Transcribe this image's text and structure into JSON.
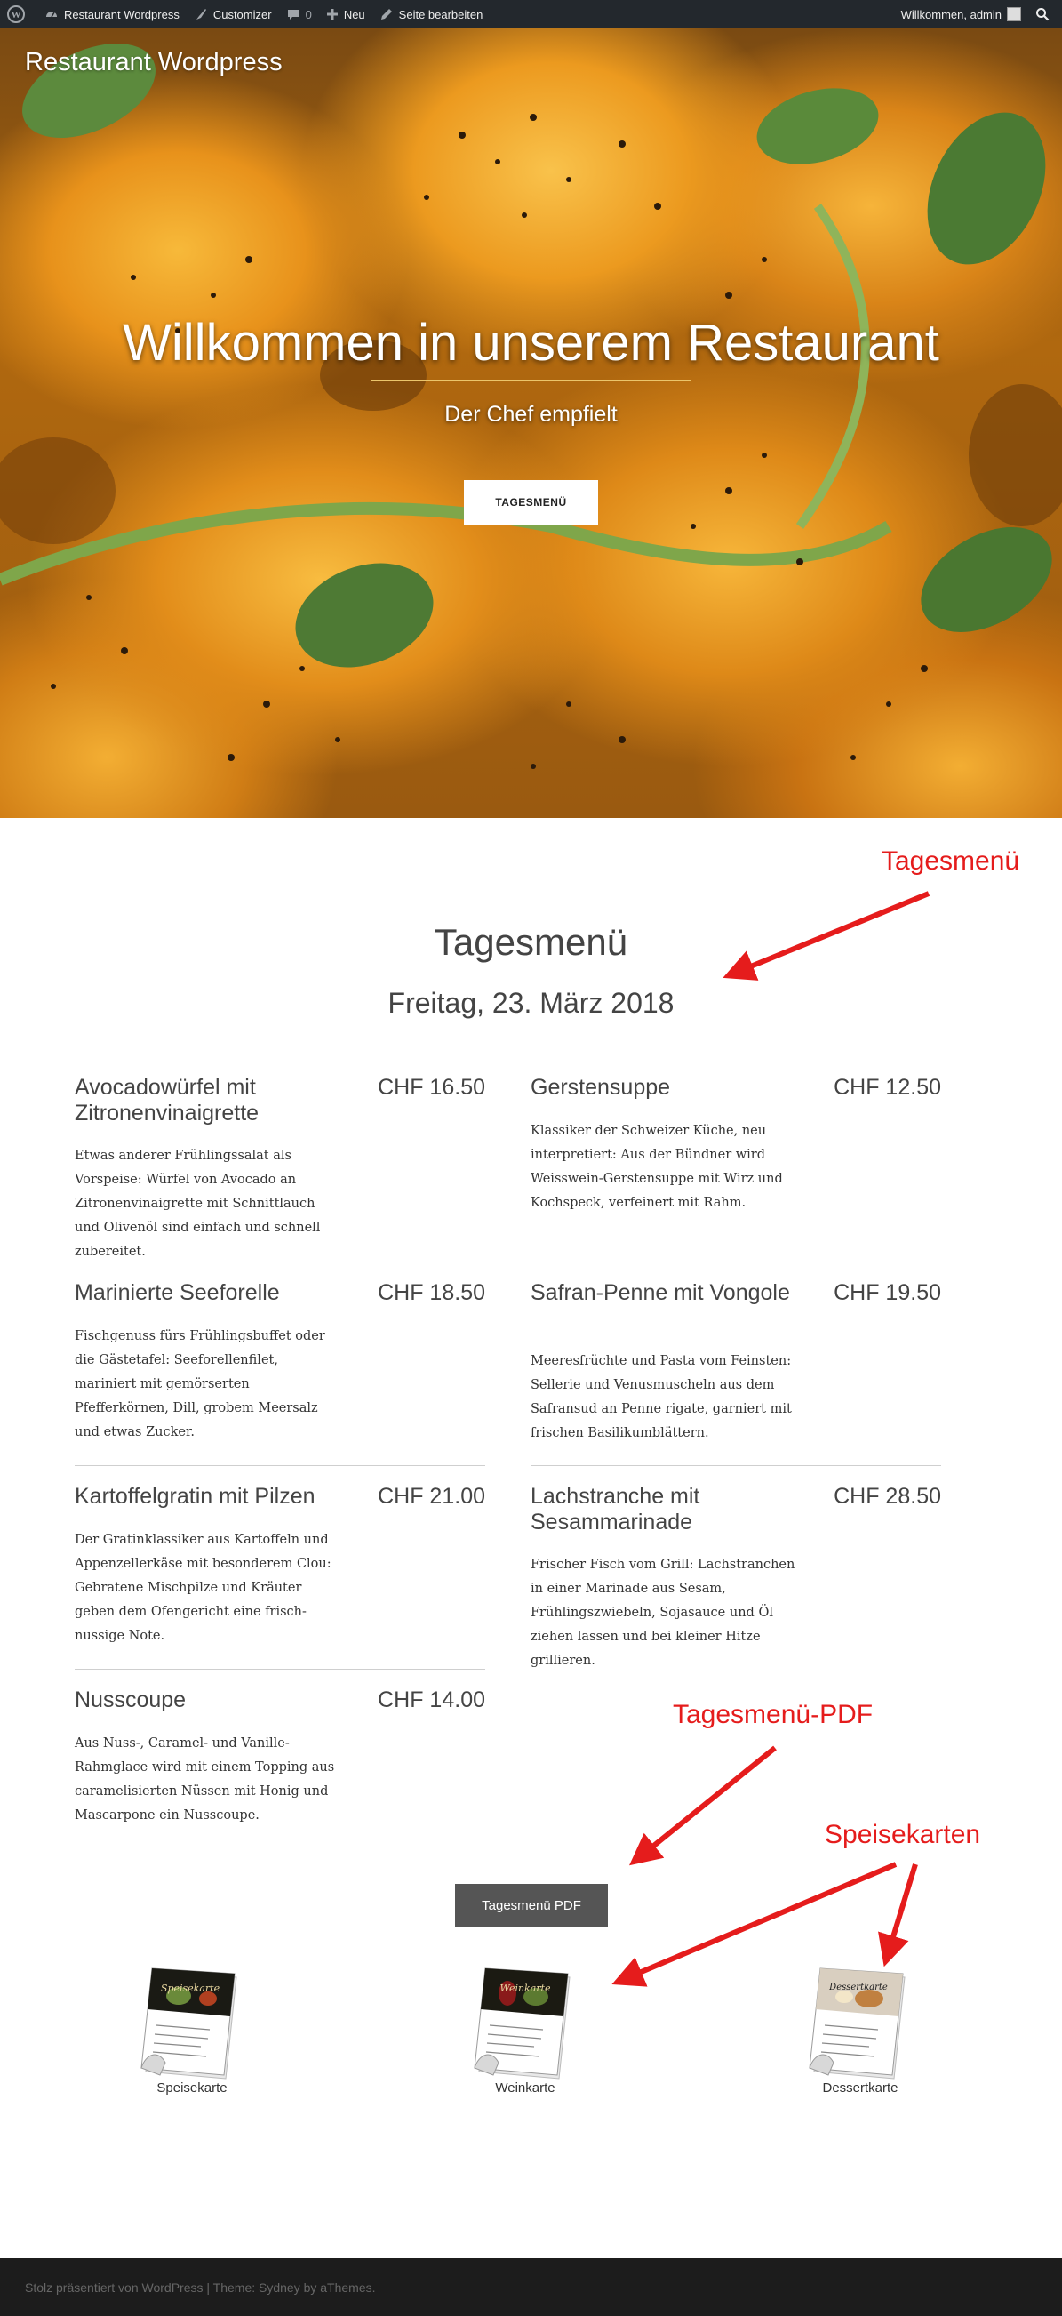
{
  "adminbar": {
    "site_name": "Restaurant Wordpress",
    "customizer": "Customizer",
    "comments_count": "0",
    "new": "Neu",
    "edit": "Seite bearbeiten",
    "greeting": "Willkommen, admin"
  },
  "hero": {
    "site_title": "Restaurant Wordpress",
    "title": "Willkommen in unserem Restaurant",
    "subtitle": "Der Chef empfielt",
    "button": "TAGESMENÜ"
  },
  "menu": {
    "title": "Tagesmenü",
    "date": "Freitag, 23. März 2018",
    "dishes": [
      {
        "name": "Avocadowürfel mit Zitronenvinaigrette",
        "price": "CHF  16.50",
        "desc": "Etwas anderer Frühlingssalat als Vorspeise: Würfel von Avocado an Zitronenvinaigrette mit Schnittlauch und Olivenöl sind einfach und schnell zubereitet."
      },
      {
        "name": "Gerstensuppe",
        "price": "CHF  12.50",
        "desc": "Klassiker der Schweizer Küche, neu interpretiert: Aus der Bündner wird Weisswein-Gerstensuppe mit Wirz und Kochspeck, verfeinert mit Rahm."
      },
      {
        "name": "Marinierte Seeforelle",
        "price": "CHF  18.50",
        "desc": "Fischgenuss fürs Frühlingsbuffet oder die Gästetafel: Seeforellenfilet, mariniert mit gemörserten Pfefferkörnen, Dill, grobem Meersalz und etwas Zucker."
      },
      {
        "name": "Safran-Penne mit Vongole",
        "price": "CHF  19.50",
        "desc": "Meeresfrüchte und Pasta vom Feinsten: Sellerie und Venusmuscheln aus dem Safransud an Penne rigate, garniert mit frischen Basilikumblättern."
      },
      {
        "name": "Kartoffelgratin mit Pilzen",
        "price": "CHF  21.00",
        "desc": "Der Gratinklassiker aus Kartoffeln und Appenzellerkäse mit besonderem Clou: Gebratene Mischpilze und Kräuter geben dem Ofengericht eine frisch-nussige Note."
      },
      {
        "name": "Lachstranche mit Sesammarinade",
        "price": "CHF  28.50",
        "desc": "Frischer Fisch vom Grill: Lachstranchen in einer Marinade aus Sesam, Frühlingszwiebeln, Sojasauce und Öl ziehen lassen und bei kleiner Hitze grillieren."
      },
      {
        "name": "Nusscoupe",
        "price": "CHF  14.00",
        "desc": "Aus Nuss-, Caramel- und Vanille-Rahmglace wird mit einem Topping aus caramelisierten Nüssen mit Honig und Mascarpone ein Nusscoupe."
      }
    ],
    "pdf_button": "Tagesmenü PDF"
  },
  "cards": [
    {
      "label": "Speisekarte",
      "cover_title": "Speisekarte"
    },
    {
      "label": "Weinkarte",
      "cover_title": "Weinkarte"
    },
    {
      "label": "Dessertkarte",
      "cover_title": "Dessertkarte"
    }
  ],
  "annotations": {
    "tagesmenu": "Tagesmenü",
    "pdf": "Tagesmenü-PDF",
    "speisekarten": "Speisekarten"
  },
  "footer": {
    "text": "Stolz präsentiert von WordPress | Theme: Sydney by aThemes."
  },
  "colors": {
    "adminbar": "#23282d",
    "annotation": "#e51c1c",
    "footer": "#1c1c1c",
    "pdf_button": "#555555"
  }
}
